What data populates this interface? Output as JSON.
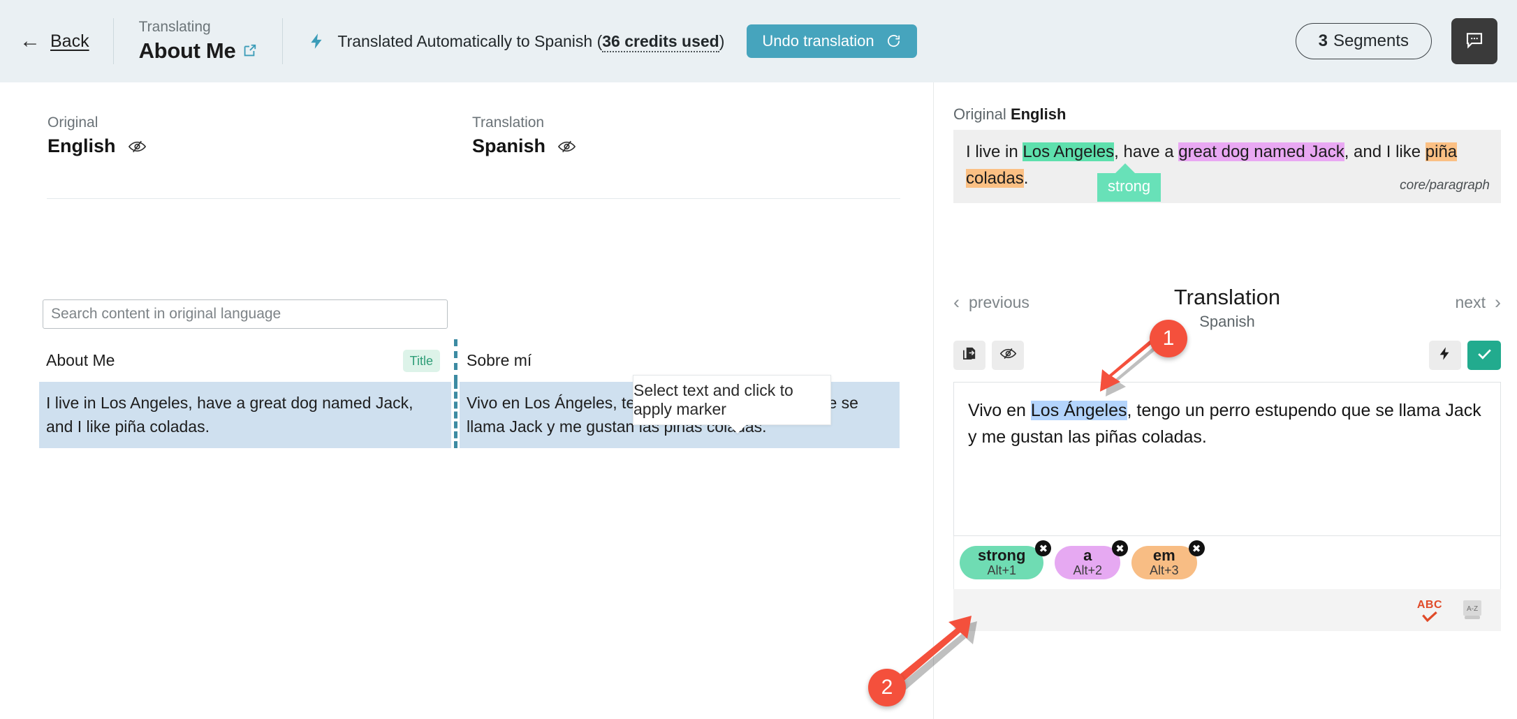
{
  "header": {
    "back_label": "Back",
    "back_arrow_icon": "arrow-left-icon",
    "kicker": "Translating",
    "doc_title": "About Me",
    "external_link_icon": "external-link-icon",
    "bolt_icon": "lightning-bolt-icon",
    "status_prefix": "Translated Automatically to Spanish (",
    "credits": "36 credits used",
    "status_suffix": ")",
    "undo_label": "Undo translation",
    "undo_icon": "undo-rotate-icon",
    "segments_count": "3",
    "segments_label": "Segments",
    "comment_icon": "comment-bubble-icon",
    "accent_blue": "#46a4bd",
    "header_bg": "#eaf0f3"
  },
  "left": {
    "original": {
      "kicker": "Original",
      "language": "English",
      "eye_icon": "eye-off-icon"
    },
    "translation": {
      "kicker": "Translation",
      "language": "Spanish",
      "eye_icon": "eye-off-icon"
    },
    "search_placeholder": "Search content in original language",
    "search_value": "",
    "rows": [
      {
        "original": "About Me",
        "badge": "Title",
        "translation": "Sobre mí",
        "selected": false
      },
      {
        "original": "I live in Los Angeles, have a great dog named Jack, and I like piña coladas.",
        "badge": "",
        "translation": "Vivo en Los Ángeles, tengo un perro estupendo que se llama Jack y me gustan las piñas coladas.",
        "selected": true
      }
    ],
    "selected_row_bg": "#cfe0ef",
    "divider_color": "#3d8ba3"
  },
  "right": {
    "original_label": "Original",
    "original_language": "English",
    "source_parts": [
      {
        "text": "I live in ",
        "mark": "none"
      },
      {
        "text": "Los Angeles",
        "mark": "green"
      },
      {
        "text": ", have a ",
        "mark": "none"
      },
      {
        "text": "great dog named Jack",
        "mark": "violet"
      },
      {
        "text": ", and I like ",
        "mark": "none"
      },
      {
        "text": "piña coladas",
        "mark": "orange"
      },
      {
        "text": ".",
        "mark": "none"
      }
    ],
    "core_tag": "core/paragraph",
    "strong_tooltip": "strong",
    "previous_label": "previous",
    "next_label": "next",
    "prev_icon": "chevron-left-icon",
    "next_icon": "chevron-right-icon",
    "panel_title": "Translation",
    "panel_subtitle": "Spanish",
    "copy_icon": "copy-to-document-icon",
    "hide_icon": "eye-off-icon",
    "machine_icon": "lightning-bolt-icon",
    "confirm_icon": "check-icon",
    "editor_before": "Vivo en ",
    "editor_selected": "Los Ángeles",
    "editor_after": ", tengo un perro estupendo que se llama Jack y me gustan las piñas coladas.",
    "tooltip_text": "Select text and click to apply marker",
    "markers": [
      {
        "name": "strong",
        "shortcut": "Alt+1",
        "color": "#6fdcb3",
        "remove_icon": "close-circle-icon"
      },
      {
        "name": "a",
        "shortcut": "Alt+2",
        "color": "#e6a9f2",
        "remove_icon": "close-circle-icon"
      },
      {
        "name": "em",
        "shortcut": "Alt+3",
        "color": "#f8bd84",
        "remove_icon": "close-circle-icon"
      }
    ],
    "spellcheck_label": "ABC",
    "spellcheck_icon": "spellcheck-icon",
    "dictionary_label": "A-Z",
    "dictionary_icon": "dictionary-book-icon",
    "highlight_green": "#5ee0ad",
    "highlight_violet": "#e9a8f3",
    "highlight_orange": "#fbc084",
    "selection_blue": "#b3d4fc",
    "confirm_green": "#22ab8e"
  },
  "annotations": {
    "marker_color": "#f4503c",
    "items": [
      {
        "number": "1"
      },
      {
        "number": "2"
      }
    ]
  }
}
